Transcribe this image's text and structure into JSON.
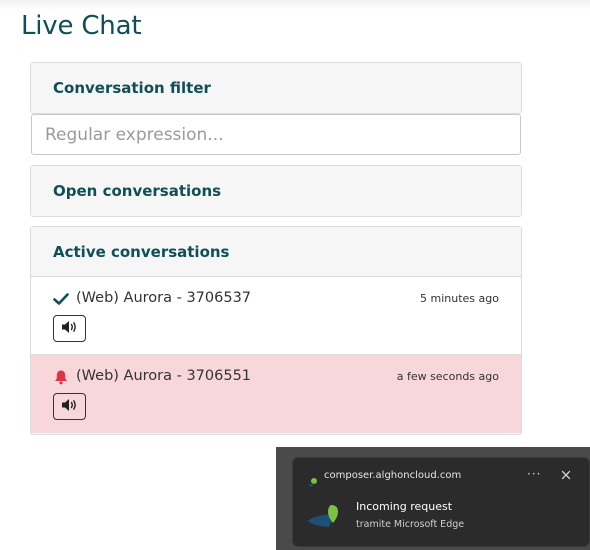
{
  "page": {
    "title": "Live Chat"
  },
  "filter": {
    "header": "Conversation filter",
    "placeholder": "Regular expression..."
  },
  "open_conversations": {
    "header": "Open conversations"
  },
  "active_conversations": {
    "header": "Active conversations",
    "items": [
      {
        "status_icon": "checkmark-icon",
        "name": "(Web) Aurora  - 3706537",
        "time": "5 minutes ago",
        "highlighted": false
      },
      {
        "status_icon": "bell-icon",
        "name": "(Web) Aurora  - 3706551",
        "time": "a few seconds ago",
        "highlighted": true
      }
    ]
  },
  "notification": {
    "origin": "composer.alghoncloud.com",
    "title": "Incoming request",
    "subtitle": "tramite Microsoft Edge",
    "more_label": "···"
  },
  "colors": {
    "heading": "#0f4f55",
    "alert_background": "#f8d7da",
    "alert_icon": "#dc3545",
    "check_icon": "#0f4f55",
    "toast_background": "#2b2b2b"
  }
}
